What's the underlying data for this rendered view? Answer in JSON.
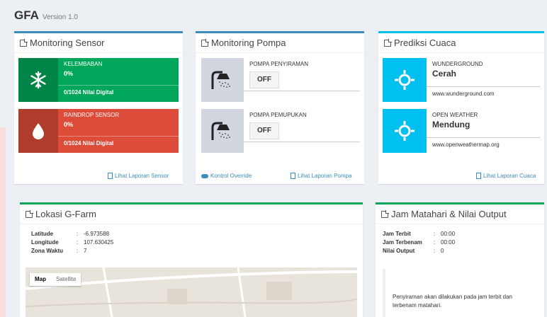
{
  "header": {
    "brand": "GFA",
    "version": "Version 1.0"
  },
  "monitoring_sensor": {
    "title": "Monitoring Sensor",
    "items": [
      {
        "label": "KELEMBABAN",
        "value": "0%",
        "desc": "0/1024 Nilai Digital",
        "icon": "snowflake-icon",
        "color": "#00a65a"
      },
      {
        "label": "RAINDROP SENSOR",
        "value": "0%",
        "desc": "0/1024 Nilai Digital",
        "icon": "drop-icon",
        "color": "#dd4b39"
      }
    ],
    "report_link": "Lihat Laporan Sensor"
  },
  "monitoring_pompa": {
    "title": "Monitoring Pompa",
    "items": [
      {
        "label": "POMPA PENYIRAMAN",
        "state": "OFF",
        "icon": "shower-icon"
      },
      {
        "label": "POMPA PEMUPUKAN",
        "state": "OFF",
        "icon": "shower-icon"
      }
    ],
    "override_link": "Kontrol Override",
    "report_link": "Lihat Laporan Pompa"
  },
  "prediksi_cuaca": {
    "title": "Prediksi Cuaca",
    "items": [
      {
        "source": "WUNDERGROUND",
        "condition": "Cerah",
        "url": "www.wunderground.com",
        "icon": "sun-icon"
      },
      {
        "source": "OPEN WEATHER",
        "condition": "Mendung",
        "url": "www.openweathermap.org",
        "icon": "sun-icon"
      }
    ],
    "report_link": "Lihat Laporan Cuaca"
  },
  "lokasi": {
    "title": "Lokasi G-Farm",
    "rows": [
      {
        "key": "Latitude",
        "value": "-6.973588"
      },
      {
        "key": "Longitude",
        "value": "107.630425"
      },
      {
        "key": "Zona Waktu",
        "value": "7"
      }
    ],
    "map_buttons": {
      "map": "Map",
      "satellite": "Satellite"
    }
  },
  "jam_matahari": {
    "title": "Jam Matahari & Nilai Output",
    "rows": [
      {
        "key": "Jam Terbit",
        "value": "00:00"
      },
      {
        "key": "Jam Terbenam",
        "value": "00:00"
      },
      {
        "key": "Nilai Output",
        "value": "0"
      }
    ],
    "note": "Penyiraman akan dilakukan pada jam terbit dan terbenam matahari."
  },
  "colors": {
    "primary": "#3c8dbc",
    "info": "#00c0ef",
    "success": "#00a65a",
    "danger": "#dd4b39"
  }
}
